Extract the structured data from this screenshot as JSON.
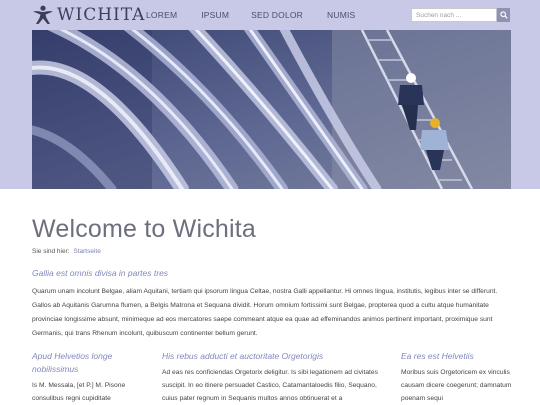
{
  "brand": {
    "name": "WICHITA"
  },
  "nav": {
    "items": [
      "LOREM",
      "IPSUM",
      "SED DOLOR",
      "NUMIS"
    ]
  },
  "search": {
    "placeholder": "Suchen nach ..."
  },
  "hero": {
    "image": "industrial pipes and workers on ladder"
  },
  "main": {
    "title": "Welcome to Wichita",
    "breadcrumb_label": "Sie sind hier:",
    "breadcrumb_link": "Startseite",
    "section_heading": "Gallia est omnis divisa in partes tres",
    "body": "Quarum unam incolunt Belgae, aliam Aquitani, tertiam qui ipsorum lingua Celtae, nostra Galli appellantur. Hi omnes lingua, institutis, legibus inter se differunt. Gallos ab Aquitanis Garumna flumen, a Belgis Matrona et Sequana dividit. Horum omnium fortissimi sunt Belgae, propterea quod a cultu atque humanitate provinciae longissime absunt, minimeque ad eos mercatores saepe commeant atque ea quae ad effeminandos animos pertinent important, proximique sunt Germanis, qui trans Rhenum incolunt, quibuscum continenter bellum gerunt."
  },
  "columns": [
    {
      "heading": "Apud Helvetios longe nobilissimus",
      "text": "Is M. Messala, [et P.] M. Pisone consulibus regni cupiditate"
    },
    {
      "heading": "His rebus adducti et auctoritate Orgetorigis",
      "text": "Ad eas res conficiendas Orgetorix deligitur. Is sibi legationem ad civitates suscipit. In eo itinere persuadet Castico, Catamantaloedis filio, Sequano, cuius pater regnum in Sequanis multos annos obtinuerat et a"
    },
    {
      "heading": "Ea res est Helvetiis",
      "text": "Moribus suis Orgetoricem ex vinculis causam dicere coegerunt; damnatum poenam sequi"
    }
  ],
  "colors": {
    "header_bg": "#c7c9e6",
    "accent": "#8288bd",
    "title": "#6d6f7e"
  },
  "icons": [
    "logo-figure-icon",
    "search-icon"
  ]
}
